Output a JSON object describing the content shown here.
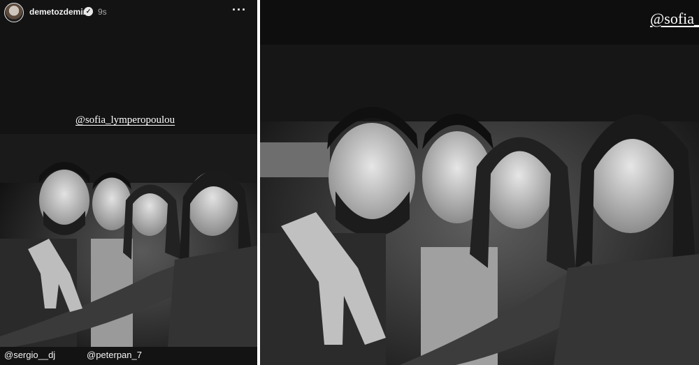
{
  "story": {
    "username": "demetozdemir",
    "verified_icon": "verified-badge-icon",
    "time_ago": "9s",
    "more_icon": "more-dots-icon",
    "more_label": "···"
  },
  "mentions": {
    "left": "@sofia_lymperopoulou",
    "right": "@sofia_lymperopoulou"
  },
  "tags": {
    "sergio": "@sergio__dj",
    "peterpan": "@peterpan_7"
  }
}
